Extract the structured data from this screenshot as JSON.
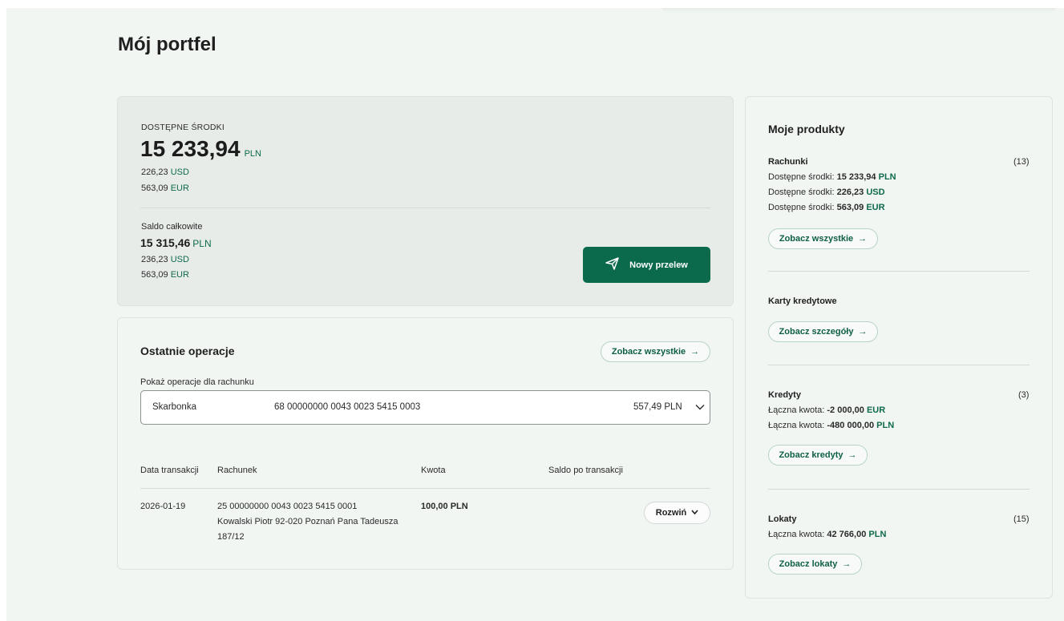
{
  "page": {
    "title": "Mój portfel"
  },
  "balance": {
    "available_label": "DOSTĘPNE ŚRODKI",
    "available_amount": "15 233,94",
    "available_currency": "PLN",
    "available_other": [
      {
        "amount": "226,23",
        "currency": "USD"
      },
      {
        "amount": "563,09",
        "currency": "EUR"
      }
    ],
    "total_label": "Saldo całkowite",
    "total_amount": "15 315,46",
    "total_currency": "PLN",
    "total_other": [
      {
        "amount": "236,23",
        "currency": "USD"
      },
      {
        "amount": "563,09",
        "currency": "EUR"
      }
    ],
    "transfer_button": "Nowy przelew"
  },
  "operations": {
    "title": "Ostatnie operacje",
    "see_all": "Zobacz wszystkie",
    "account_label": "Pokaż operacje dla rachunku",
    "selected_account": {
      "name": "Skarbonka",
      "number": "68 00000000 0043 0023 5415 0003",
      "balance": "557,49 PLN"
    },
    "columns": [
      "Data transakcji",
      "Rachunek",
      "Kwota",
      "Saldo po transakcji"
    ],
    "rows": [
      {
        "date": "2026-01-19",
        "account_line1": "25 00000000 0043 0023 5415 0001",
        "account_line2": "Kowalski Piotr 92-020 Poznań Pana Tadeusza",
        "account_line3": "187/12",
        "amount": "100,00 PLN",
        "balance_after": "",
        "expand": "Rozwiń"
      }
    ]
  },
  "products": {
    "title": "Moje produkty",
    "accounts": {
      "label": "Rachunki",
      "count": "(13)",
      "lines": [
        {
          "prefix": "Dostępne środki:",
          "amount": "15 233,94",
          "currency": "PLN"
        },
        {
          "prefix": "Dostępne środki:",
          "amount": "226,23",
          "currency": "USD"
        },
        {
          "prefix": "Dostępne środki:",
          "amount": "563,09",
          "currency": "EUR"
        }
      ],
      "button": "Zobacz wszystkie"
    },
    "cards": {
      "label": "Karty kredytowe",
      "button": "Zobacz szczegóły"
    },
    "loans": {
      "label": "Kredyty",
      "count": "(3)",
      "lines": [
        {
          "prefix": "Łączna kwota:",
          "amount": "-2 000,00",
          "currency": "EUR"
        },
        {
          "prefix": "Łączna kwota:",
          "amount": "-480 000,00",
          "currency": "PLN"
        }
      ],
      "button": "Zobacz kredyty"
    },
    "deposits": {
      "label": "Lokaty",
      "count": "(15)",
      "lines": [
        {
          "prefix": "Łączna kwota:",
          "amount": "42 766,00",
          "currency": "PLN"
        }
      ],
      "button": "Zobacz lokaty"
    }
  },
  "icons": {
    "arrow": "arrow-right-icon",
    "send": "send-icon",
    "chevron": "chevron-down-icon"
  },
  "colors": {
    "brand": "#0b6a4c",
    "background": "#f1f6f3",
    "card_gray": "#e8ece9"
  }
}
